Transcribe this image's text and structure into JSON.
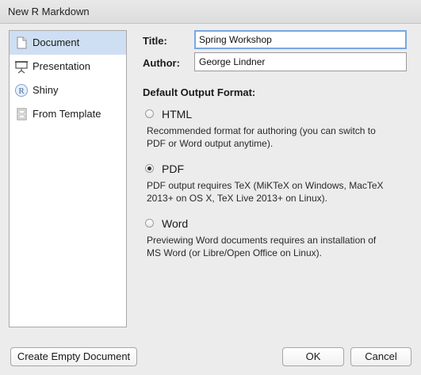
{
  "window": {
    "title": "New R Markdown"
  },
  "sidebar": {
    "items": [
      {
        "label": "Document",
        "icon": "document-icon",
        "selected": true
      },
      {
        "label": "Presentation",
        "icon": "presentation-icon",
        "selected": false
      },
      {
        "label": "Shiny",
        "icon": "shiny-r-icon",
        "selected": false
      },
      {
        "label": "From Template",
        "icon": "template-icon",
        "selected": false
      }
    ]
  },
  "form": {
    "title_label": "Title:",
    "title_value": "Spring Workshop",
    "author_label": "Author:",
    "author_value": "George Lindner"
  },
  "output": {
    "section_title": "Default Output Format:",
    "selected": "PDF",
    "options": [
      {
        "label": "HTML",
        "description": "Recommended format for authoring (you can switch to\nPDF or Word output anytime).",
        "checked": false
      },
      {
        "label": "PDF",
        "description": "PDF output requires TeX (MiKTeX on Windows, MacTeX\n2013+ on OS X, TeX Live 2013+ on Linux).",
        "checked": true
      },
      {
        "label": "Word",
        "description": "Previewing Word documents requires an installation of\nMS Word (or Libre/Open Office on Linux).",
        "checked": false
      }
    ]
  },
  "footer": {
    "create_empty_label": "Create Empty Document",
    "ok_label": "OK",
    "cancel_label": "Cancel"
  },
  "colors": {
    "selected_item_bg": "#cfdff3",
    "focus_ring": "#7aa7e0",
    "dialog_bg": "#ececec"
  }
}
